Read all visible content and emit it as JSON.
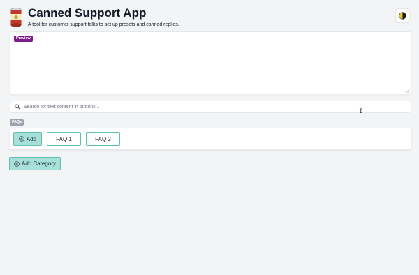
{
  "header": {
    "title": "Canned Support App",
    "subtitle": "A tool for customer support folks to set up presets and canned replies."
  },
  "preview": {
    "badge": "Preview",
    "value": ""
  },
  "search": {
    "placeholder": "Search for text content in buttons..."
  },
  "categories": [
    {
      "name": "FAQs",
      "add_label": "Add",
      "buttons": [
        {
          "label": "FAQ 1"
        },
        {
          "label": "FAQ 2"
        }
      ]
    }
  ],
  "add_category_label": "Add Category",
  "colors": {
    "accent": "#a7e0d8",
    "accent_border": "#5fbfae",
    "preview_badge": "#7e1b8f",
    "category_badge": "#9ca3af"
  },
  "icons": [
    "soup-can-icon",
    "theme-toggle-icon",
    "search-icon",
    "plus-circle-icon"
  ]
}
